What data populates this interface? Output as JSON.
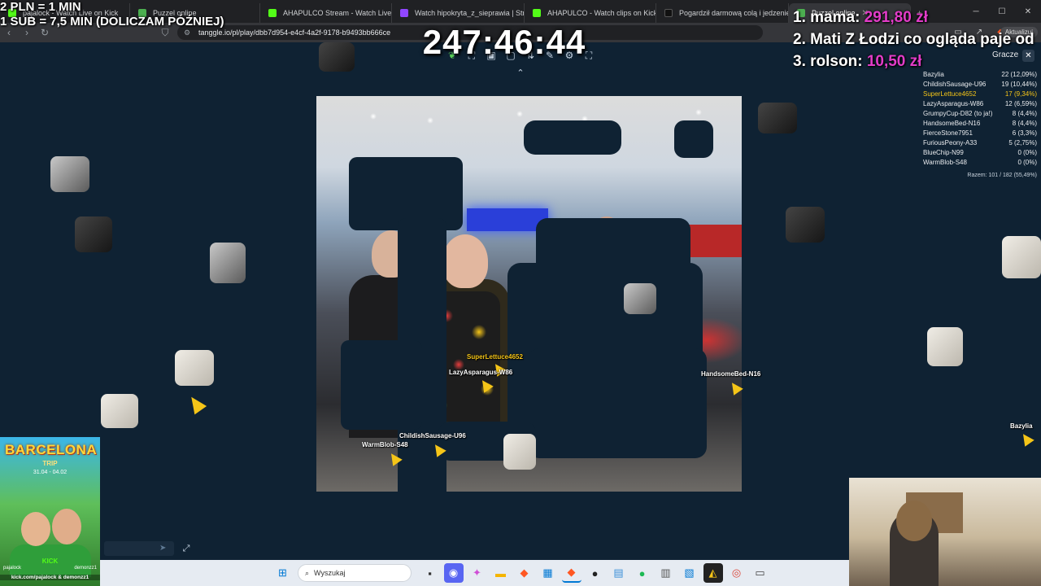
{
  "browser": {
    "tabs": [
      {
        "label": "pajalock - Watch Live on Kick",
        "color": "#53fc18"
      },
      {
        "label": "Puzzel online",
        "color": "#4caf50"
      },
      {
        "label": "AHAPULCO Stream - Watch Live on K",
        "color": "#53fc18"
      },
      {
        "label": "Watch hipokryta_z_sieprawia | Stream",
        "color": "#9146ff"
      },
      {
        "label": "AHAPULCO - Watch clips on Kick",
        "color": "#53fc18"
      },
      {
        "label": "Pogardził darmową colą i jedzeniem",
        "color": "#111111"
      },
      {
        "label": "Puzzel online",
        "color": "#4caf50"
      }
    ],
    "new_tab": "+",
    "url": "tanggle.io/pl/play/dbb7d954-e4cf-4a2f-9178-b9493bb666ce",
    "update_label": "Aktualizuj"
  },
  "overlay": {
    "rule_pln": "2 PLN = 1 MIN",
    "rule_sub": "1 SUB = 7,5 MIN (DOLICZAM PÓŹNIEJ)",
    "timer": "247:46:44"
  },
  "donors": [
    {
      "rank": "1.",
      "name": "mama:",
      "amount": "291,80 zł"
    },
    {
      "rank": "2.",
      "name": "Mati Z Łodzi co ogląda paje od",
      "amount": ""
    },
    {
      "rank": "3.",
      "name": "rolson:",
      "amount": "10,50 zł"
    }
  ],
  "players_panel": {
    "title": "Gracze",
    "close": "✕",
    "players": [
      {
        "name": "Bazylia",
        "score": "22 (12,09%)",
        "self": false
      },
      {
        "name": "ChildishSausage-U96",
        "score": "19 (10,44%)",
        "self": false
      },
      {
        "name": "SuperLettuce4652",
        "score": "17 (9,34%)",
        "self": true
      },
      {
        "name": "LazyAsparagus-W86",
        "score": "12 (6,59%)",
        "self": false
      },
      {
        "name": "GrumpyCup-D82 (to ja!)",
        "score": "8 (4,4%)",
        "self": false
      },
      {
        "name": "HandsomeBed-N16",
        "score": "8 (4,4%)",
        "self": false
      },
      {
        "name": "FierceStone7951",
        "score": "6 (3,3%)",
        "self": false
      },
      {
        "name": "FuriousPeony-A33",
        "score": "5 (2,75%)",
        "self": false
      },
      {
        "name": "BlueChip-N99",
        "score": "0 (0%)",
        "self": false
      },
      {
        "name": "WarmBlob-S48",
        "score": "0 (0%)",
        "self": false
      }
    ],
    "total": "Razem: 101 / 182 (55,49%)"
  },
  "cursors": {
    "superlettuce": "SuperLettuce4652",
    "lazyasparagus": "LazyAsparagus-W86",
    "handsomebed": "HandsomeBed-N16",
    "childish": "ChildishSausage-U96",
    "warmblob": "WarmBlob-S48",
    "bazylia": "Bazylia"
  },
  "promo": {
    "title": "BARCELONA",
    "subtitle": "TRIP",
    "dates": "31.04 - 04.02",
    "kick": "KICK",
    "left_handle": "pajalock",
    "right_handle": "demonzz1",
    "url": "kick.com/pajalock & demonzz1"
  },
  "taskbar": {
    "search_placeholder": "Wyszukaj"
  }
}
